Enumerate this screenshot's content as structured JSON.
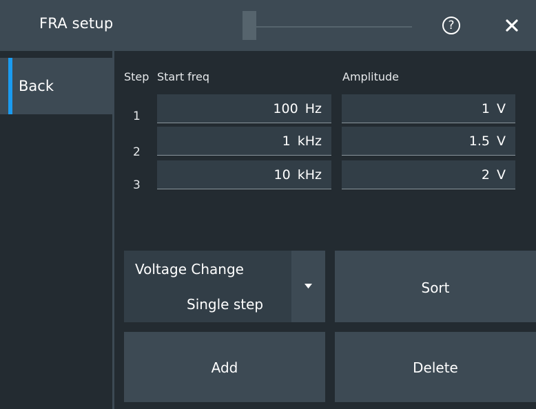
{
  "window": {
    "title": "FRA setup",
    "help_glyph": "?",
    "close_glyph": "✕"
  },
  "sidebar": {
    "back_label": "Back"
  },
  "table": {
    "headers": {
      "step": "Step",
      "start_freq": "Start freq",
      "amplitude": "Amplitude"
    },
    "rows": [
      {
        "step": "1",
        "start_freq": "100 Hz",
        "amplitude": "1 V"
      },
      {
        "step": "2",
        "start_freq": "1 kHz",
        "amplitude": "1.5 V"
      },
      {
        "step": "3",
        "start_freq": "10 kHz",
        "amplitude": "2 V"
      }
    ]
  },
  "voltage_change": {
    "label": "Voltage Change",
    "value": "Single step"
  },
  "buttons": {
    "sort": "Sort",
    "add": "Add",
    "delete": "Delete"
  },
  "colors": {
    "background": "#232b31",
    "panel": "#3d4a54",
    "cell": "#323e47",
    "accent": "#1a9bf0"
  }
}
